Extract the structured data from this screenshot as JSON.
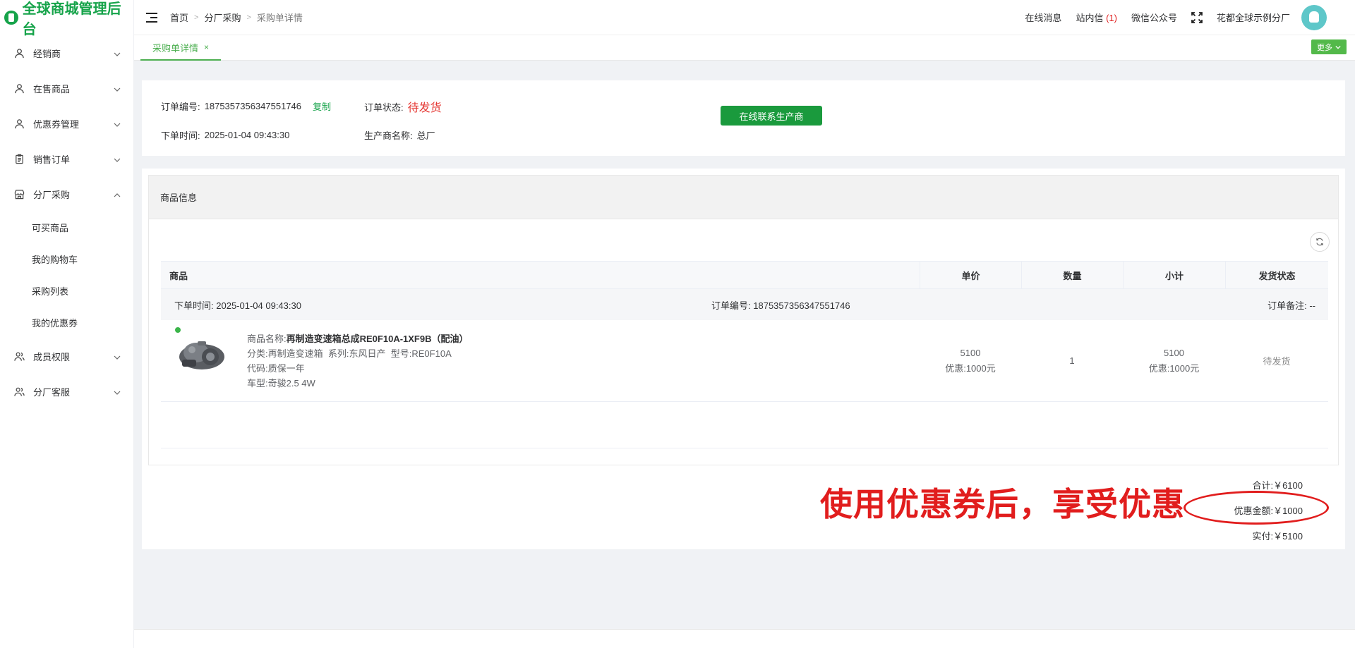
{
  "app": {
    "title": "全球商城管理后台"
  },
  "sidebar": {
    "items": [
      {
        "label": "经销商",
        "icon": "user-icon",
        "expanded": false
      },
      {
        "label": "在售商品",
        "icon": "user-icon",
        "expanded": false
      },
      {
        "label": "优惠券管理",
        "icon": "user-icon",
        "expanded": false
      },
      {
        "label": "销售订单",
        "icon": "clipboard-icon",
        "expanded": false
      },
      {
        "label": "分厂采购",
        "icon": "store-icon",
        "expanded": true,
        "children": [
          {
            "label": "可买商品"
          },
          {
            "label": "我的购物车"
          },
          {
            "label": "采购列表"
          },
          {
            "label": "我的优惠券"
          }
        ]
      },
      {
        "label": "成员权限",
        "icon": "users-icon",
        "expanded": false
      },
      {
        "label": "分厂客服",
        "icon": "users-icon",
        "expanded": false
      }
    ]
  },
  "header": {
    "breadcrumb": [
      "首页",
      "分厂采购",
      "采购单详情"
    ],
    "links": {
      "online_msg": "在线消息",
      "inbox": "站内信",
      "inbox_count": "(1)",
      "wechat": "微信公众号",
      "user": "花都全球示例分厂"
    }
  },
  "tabs": {
    "active": "采购单详情",
    "close": "×",
    "more": "更多"
  },
  "order": {
    "no_label": "订单编号:",
    "no": "1875357356347551746",
    "copy": "复制",
    "status_label": "订单状态:",
    "status": "待发货",
    "time_label": "下单时间:",
    "time": "2025-01-04 09:43:30",
    "maker_label": "生产商名称:",
    "maker": "总厂",
    "contact_btn": "在线联系生产商"
  },
  "goods": {
    "section_title": "商品信息",
    "columns": [
      "商品",
      "单价",
      "数量",
      "小计",
      "发货状态"
    ],
    "group": {
      "time_label": "下单时间:",
      "time": "2025-01-04 09:43:30",
      "no_label": "订单编号:",
      "no": "1875357356347551746",
      "remark_label": "订单备注:",
      "remark": "--"
    },
    "item": {
      "name_label": "商品名称:",
      "name": "再制造变速箱总成RE0F10A-1XF9B（配油）",
      "category_label": "分类:",
      "category": "再制造变速箱",
      "series_label": "系列:",
      "series": "东风日产",
      "model_label": "型号:",
      "model": "RE0F10A",
      "code_label": "代码:",
      "code": "质保一年",
      "car_label": "车型:",
      "car": "奇骏2.5 4W",
      "price": "5100",
      "price_discount": "优惠:1000元",
      "qty": "1",
      "subtotal": "5100",
      "subtotal_discount": "优惠:1000元",
      "ship_status": "待发货"
    }
  },
  "totals": {
    "total": "合计:￥6100",
    "discount": "优惠金额:￥1000",
    "paid": "实付:￥5100"
  },
  "annotation": "使用优惠券后，享受优惠",
  "colors": {
    "brand": "#16a34a",
    "accent": "#4caf50",
    "danger": "#e53935"
  }
}
